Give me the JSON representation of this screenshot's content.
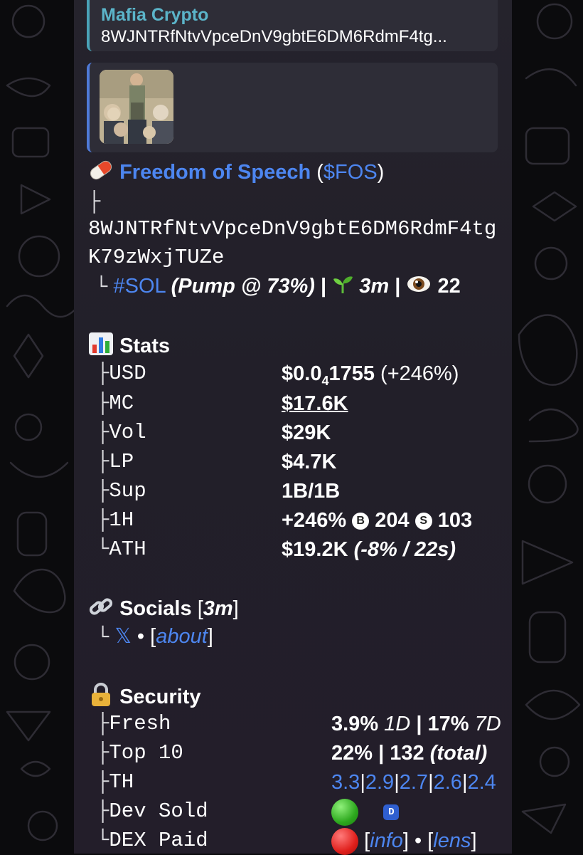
{
  "reply": {
    "name": "Mafia Crypto",
    "text": "8WJNTRfNtvVpceDnV9gbtE6DM6RdmF4tg..."
  },
  "header": {
    "token_name": "Freedom of Speech",
    "paren_open": "(",
    "ticker": "$FOS",
    "paren_close": ")",
    "branch": "├",
    "address_line1": "8WJNTRfNtvVpceDnV9gbtE6DM6RdmF4tg",
    "address_line2": "K79zWxjTUZe",
    "last_branch": "└",
    "chain": "#SOL",
    "pump": "(Pump @ 73%)",
    "sep1": "|",
    "age": "3m",
    "sep2": "|",
    "views": "22"
  },
  "stats": {
    "title": "Stats",
    "rows": [
      {
        "branch": "├",
        "label": "USD",
        "value_main": "$0.0",
        "value_sub": "4",
        "value_rest": "1755",
        "value_extra": " (+246%)"
      },
      {
        "branch": "├",
        "label": "MC",
        "value": "$17.6K"
      },
      {
        "branch": "├",
        "label": "Vol",
        "value": "$29K"
      },
      {
        "branch": "├",
        "label": "LP",
        "value": "$4.7K"
      },
      {
        "branch": "├",
        "label": "Sup",
        "value": "1B/1B"
      },
      {
        "branch": "├",
        "label": "1H",
        "value": "+246%",
        "buys": "204",
        "sells": "103",
        "buy_glyph": "B",
        "sell_glyph": "S"
      },
      {
        "branch": "└",
        "label": "ATH",
        "value": "$19.2K",
        "extra": "(-8% / 22s)"
      }
    ]
  },
  "socials": {
    "title": "Socials",
    "open": "[",
    "age": "3m",
    "close": "]",
    "branch": "└",
    "x_label": "𝕏",
    "dot": "•",
    "about_open": "[",
    "about": "about",
    "about_close": "]"
  },
  "security": {
    "title": "Security",
    "fresh": {
      "branch": "├",
      "label": "Fresh",
      "v1": "3.9%",
      "v1_suffix": "1D",
      "sep": "|",
      "v2": "17%",
      "v2_suffix": "7D"
    },
    "top10": {
      "branch": "├",
      "label": "Top 10",
      "v1": "22%",
      "sep": "|",
      "v2": "132",
      "v2_suffix": "(total)"
    },
    "th": {
      "branch": "├",
      "label": "TH",
      "values": [
        "3.3",
        "2.9",
        "2.7",
        "2.6",
        "2.4"
      ],
      "sep": "|"
    },
    "dev_sold": {
      "branch": "├",
      "label": "Dev Sold",
      "status_color": "#2da81e",
      "badge": "D"
    },
    "dex_paid": {
      "branch": "└",
      "label": "DEX Paid",
      "status_color": "#e0201c",
      "open": "[",
      "info": "info",
      "close": "]",
      "dot": "•",
      "open2": "[",
      "lens": "lens",
      "close2": "]"
    }
  },
  "colors": {
    "link": "#4d86f0",
    "reply_accent": "#5bb4c9"
  }
}
